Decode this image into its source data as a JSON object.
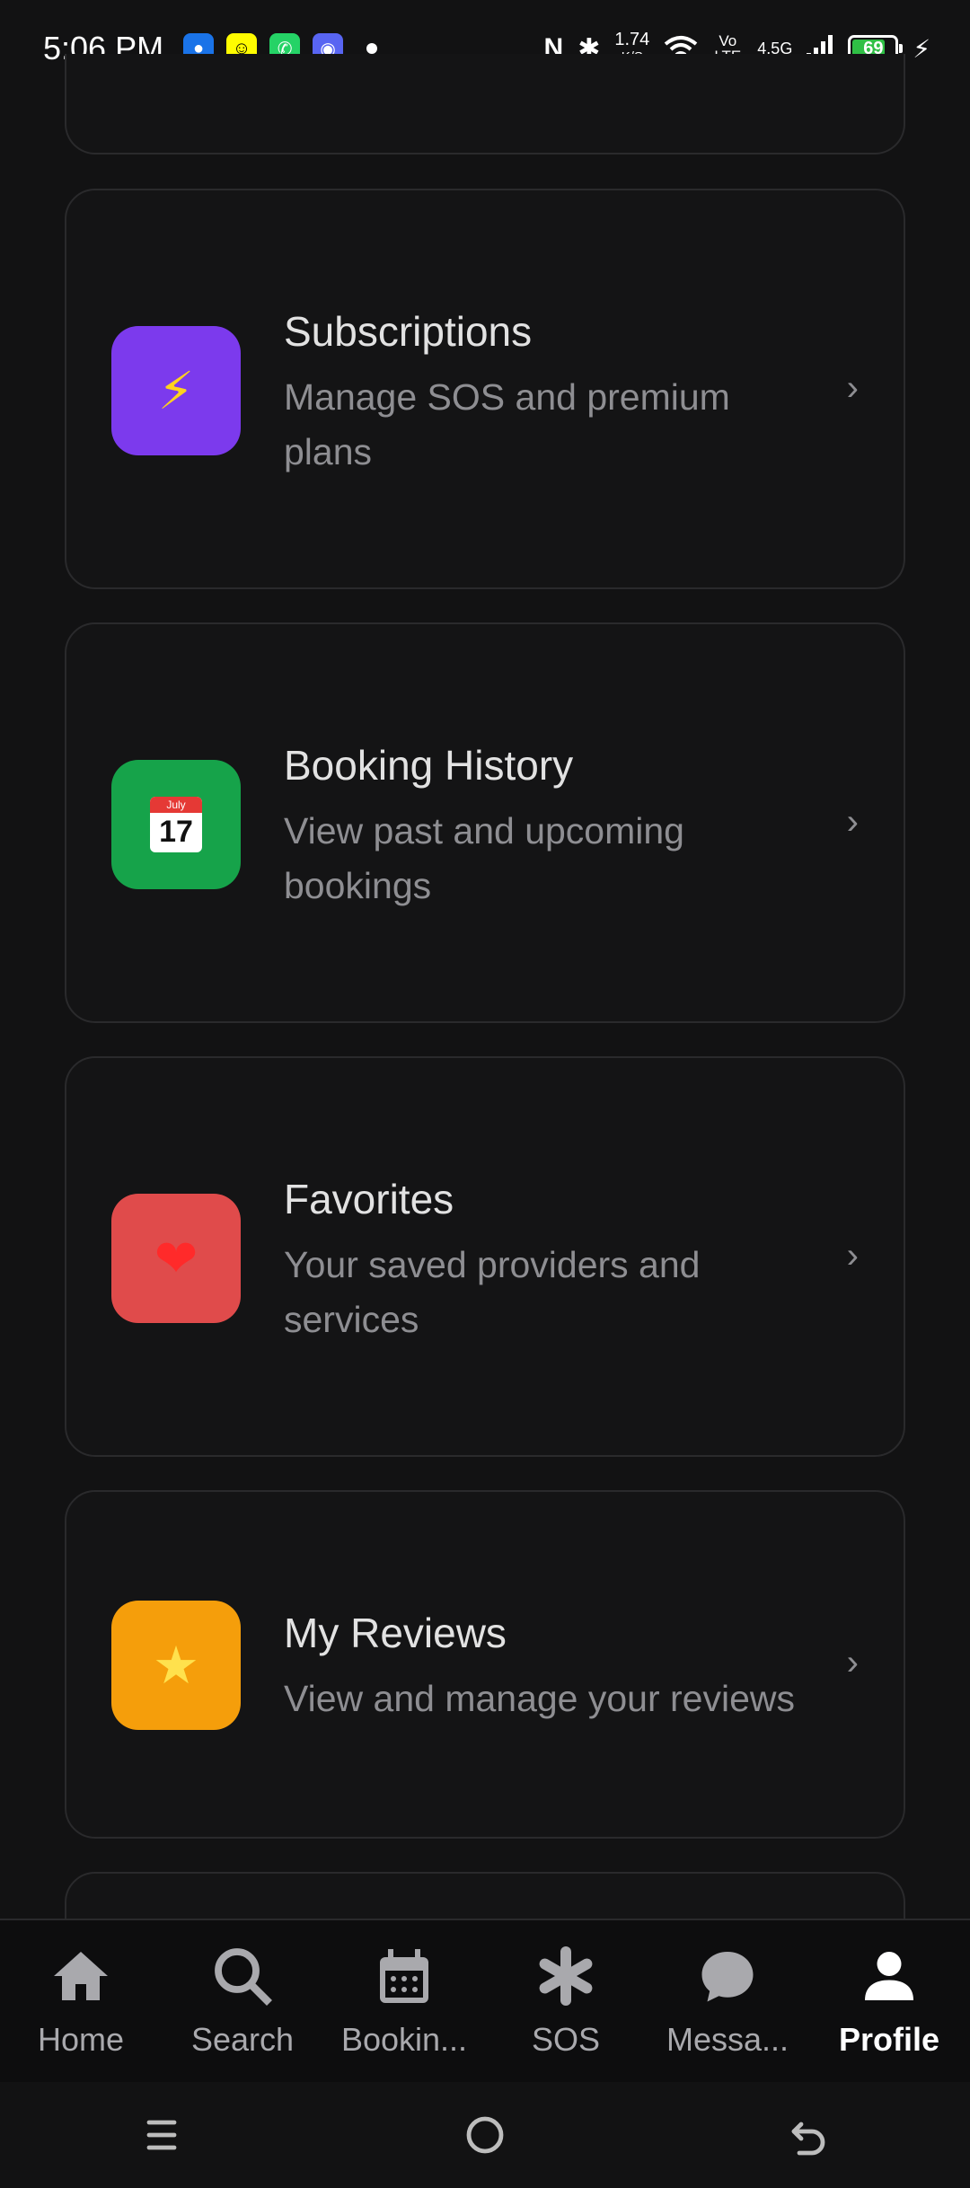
{
  "status_bar": {
    "time": "5:06 PM",
    "net_speed_value": "1.74",
    "net_speed_unit": "K/S",
    "volte": "Vo LTE",
    "network": "4.5G",
    "battery": "69"
  },
  "cards": [
    {
      "title": "Subscriptions",
      "subtitle": "Manage SOS and premium plans",
      "icon": "lightning-icon",
      "glyph": "⚡",
      "color": "#7c3aed"
    },
    {
      "title": "Booking History",
      "subtitle": "View past and upcoming bookings",
      "icon": "calendar-icon",
      "glyph": "July 17",
      "color": "#16a34a"
    },
    {
      "title": "Favorites",
      "subtitle": "Your saved providers and services",
      "icon": "heart-icon",
      "glyph": "❤️",
      "color": "#e04b4b"
    },
    {
      "title": "My Reviews",
      "subtitle": "View and manage your reviews",
      "icon": "star-icon",
      "glyph": "⭐",
      "color": "#f59e0b"
    }
  ],
  "calendar_glyph": {
    "month": "July",
    "day": "17"
  },
  "tab_bar": {
    "tabs": [
      {
        "label": "Home",
        "icon": "home-icon"
      },
      {
        "label": "Search",
        "icon": "search-icon"
      },
      {
        "label": "Bookin...",
        "icon": "calendar-icon"
      },
      {
        "label": "SOS",
        "icon": "asterisk-icon"
      },
      {
        "label": "Messa...",
        "icon": "chat-bubble-icon"
      },
      {
        "label": "Profile",
        "icon": "person-icon",
        "active": true
      }
    ]
  },
  "system_nav": [
    "menu-icon",
    "home-circle-icon",
    "back-icon"
  ]
}
